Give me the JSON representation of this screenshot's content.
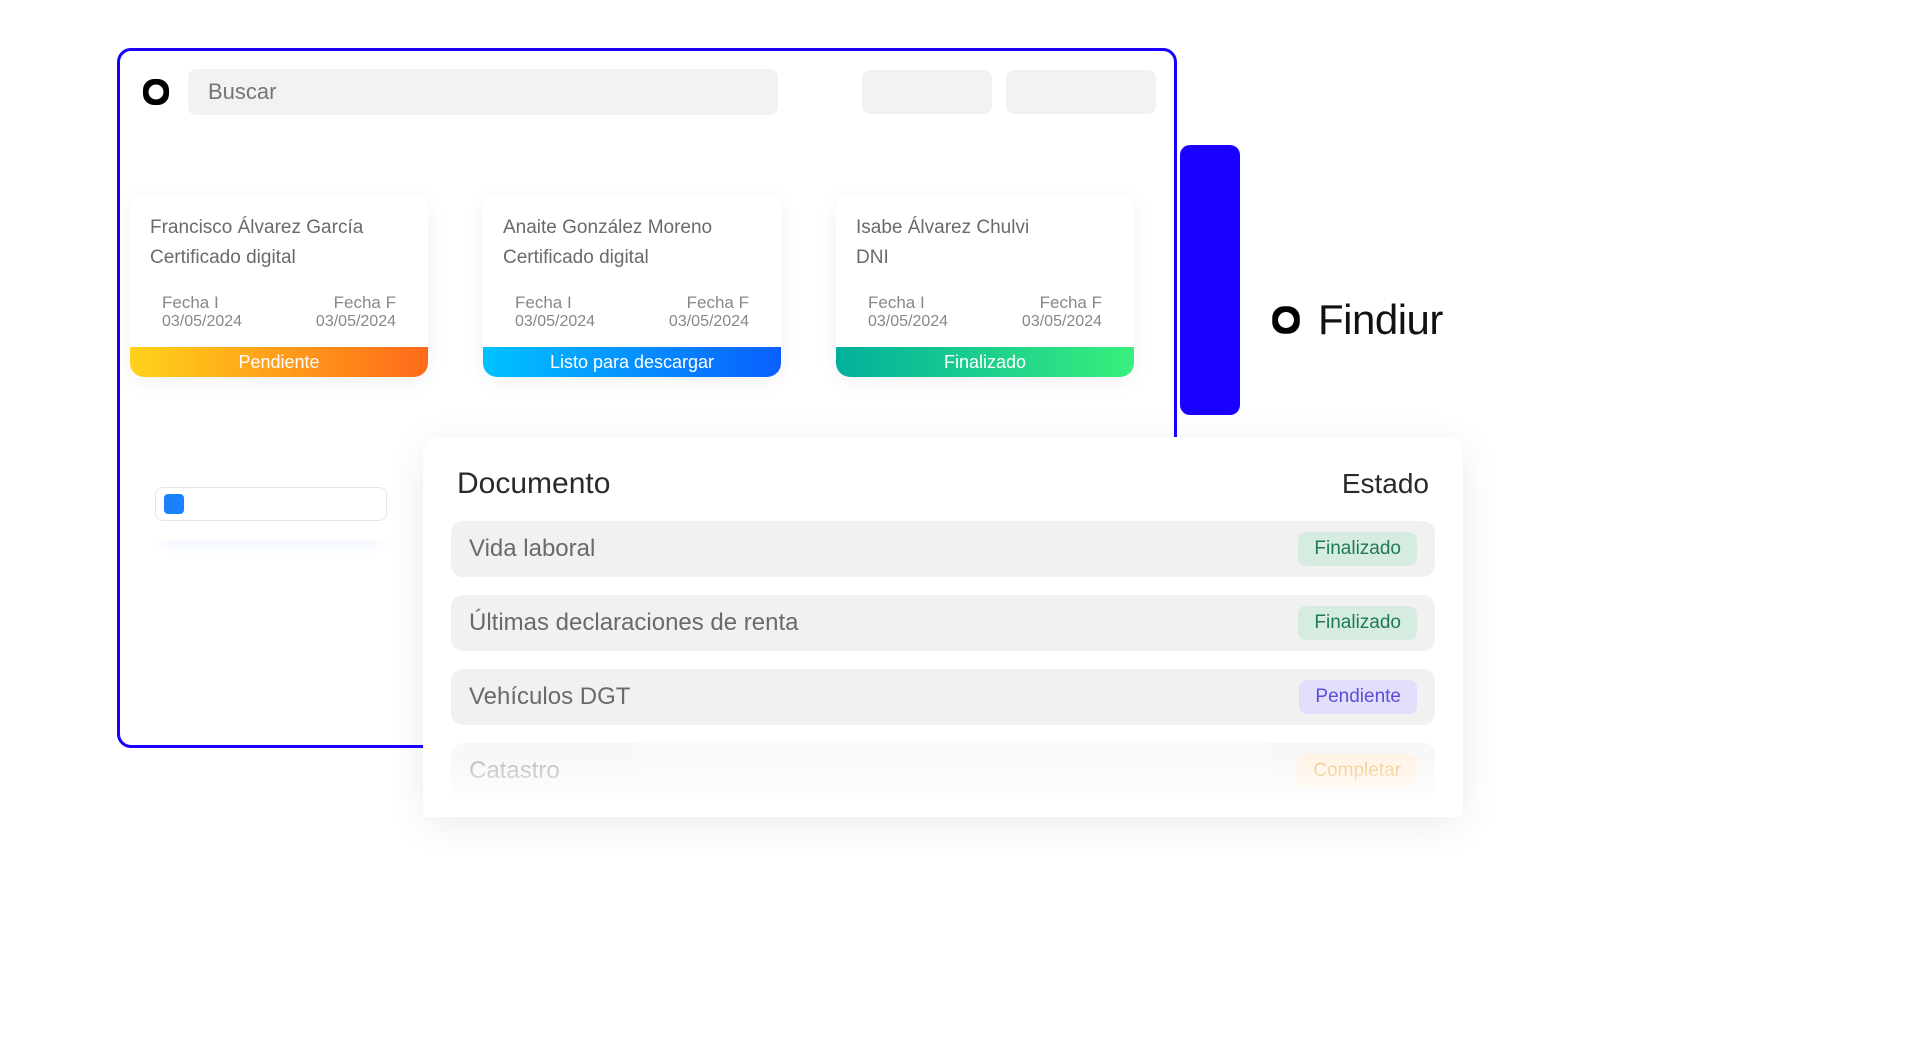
{
  "brand": {
    "name": "Findiur"
  },
  "search": {
    "placeholder": "Buscar"
  },
  "dateLabels": {
    "start": "Fecha I",
    "end": "Fecha F"
  },
  "cards": [
    {
      "name": "Francisco Álvarez García",
      "docType": "Certificado digital",
      "startDate": "03/05/2024",
      "endDate": "03/05/2024",
      "status": "Pendiente",
      "statusColor": "orange"
    },
    {
      "name": "Anaite González Moreno",
      "docType": "Certificado digital",
      "startDate": "03/05/2024",
      "endDate": "03/05/2024",
      "status": "Listo para descargar",
      "statusColor": "blue"
    },
    {
      "name": "Isabe Álvarez Chulvi",
      "docType": "DNI",
      "startDate": "03/05/2024",
      "endDate": "03/05/2024",
      "status": "Finalizado",
      "statusColor": "green"
    }
  ],
  "docsPanel": {
    "colDocument": "Documento",
    "colState": "Estado",
    "rows": [
      {
        "title": "Vida laboral",
        "status": "Finalizado",
        "badge": "finalizado"
      },
      {
        "title": "Últimas declaraciones de renta",
        "status": "Finalizado",
        "badge": "finalizado"
      },
      {
        "title": "Vehículos DGT",
        "status": "Pendiente",
        "badge": "pendiente"
      },
      {
        "title": "Catastro",
        "status": "Completar",
        "badge": "completar"
      }
    ]
  }
}
